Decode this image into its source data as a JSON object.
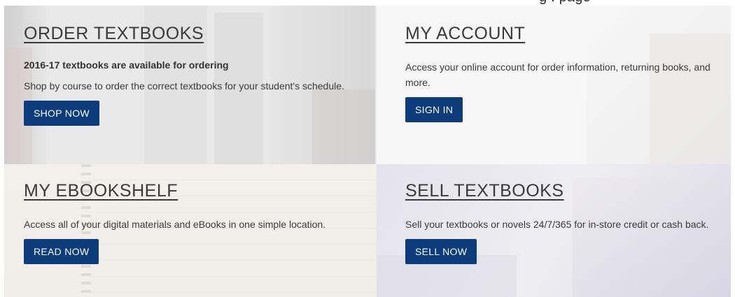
{
  "header": {
    "partial_text": "g  .    page"
  },
  "cards": [
    {
      "title": "ORDER TEXTBOOKS",
      "subtitle": "2016-17 textbooks are available for ordering",
      "description": "Shop by course to order the correct textbooks for your student's schedule.",
      "button": "SHOP NOW"
    },
    {
      "title": "MY ACCOUNT",
      "description": "Access your online account for order information, returning books, and more.",
      "button": "SIGN IN"
    },
    {
      "title": "MY EBOOKSHELF",
      "description": "Access all of your digital materials and eBooks in one simple location.",
      "button": "READ NOW"
    },
    {
      "title": "SELL TEXTBOOKS",
      "description": "Sell your textbooks or novels 24/7/365 for in-store credit or cash back.",
      "button": "SELL NOW"
    }
  ],
  "colors": {
    "button_bg": "#0c3c7c",
    "button_text": "#ffffff",
    "heading": "#3a3a3a"
  }
}
